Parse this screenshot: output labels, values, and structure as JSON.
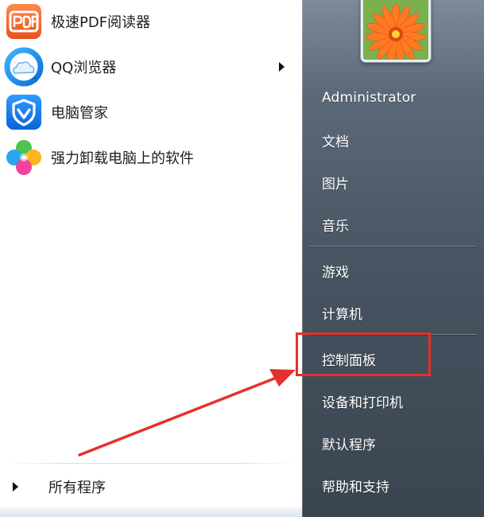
{
  "programs": [
    {
      "label": "极速PDF阅读器",
      "icon": "pdf-reader-icon",
      "has_submenu": false
    },
    {
      "label": "QQ浏览器",
      "icon": "qq-browser-icon",
      "has_submenu": true
    },
    {
      "label": "电脑管家",
      "icon": "pc-manager-shield-icon",
      "has_submenu": false
    },
    {
      "label": "强力卸载电脑上的软件",
      "icon": "uninstaller-clover-icon",
      "has_submenu": false
    }
  ],
  "all_programs": {
    "label": "所有程序"
  },
  "right_menu": {
    "user": "Administrator",
    "items": [
      "文档",
      "图片",
      "音乐",
      "游戏",
      "计算机",
      "控制面板",
      "设备和打印机",
      "默认程序",
      "帮助和支持"
    ]
  },
  "annotation": {
    "highlighted_item": "控制面板",
    "box_color": "#e6302b",
    "arrow_color": "#e6302b"
  },
  "colors": {
    "right_pane_top": "#7d8a99",
    "right_pane_bottom": "#3a4551",
    "text_left": "#1e1e1e",
    "text_right": "#ffffff"
  }
}
